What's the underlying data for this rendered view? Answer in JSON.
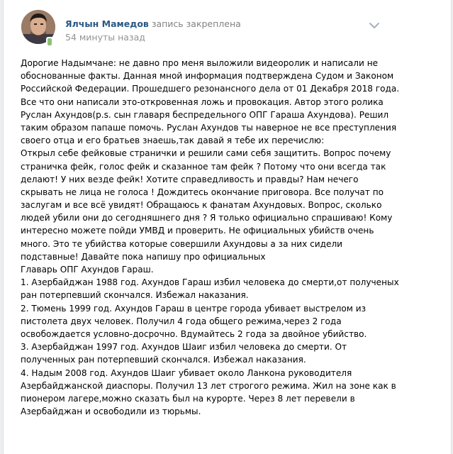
{
  "post": {
    "author_name": "Ялчын Мамедов",
    "action_text": "запись закреплена",
    "time": "54 минуты назад",
    "lines": [
      "Дорогие Надымчане: не давно про меня выложили видеоролик и написали не",
      "обоснованные факты. Данная мной информация подтверждена Судом и Законом",
      "Российской Федерации. Прошедшего резонансного дела от 01 Декабря 2018 года.",
      "Все что они написали это-откровенная ложь и провокация. Автор этого ролика",
      "Руслан Ахундов(p.s. сын главаря беспредельного ОПГ Гараша Ахундова). Решил",
      "таким образом папаше помочь. Руслан Ахундов ты наверное не все преступления",
      "своего отца и его братьев знаешь,так давай я тебе их перечислю:",
      "Открыл себе фейковые странички и решили сами себя защитить. Вопрос почему",
      "страничка фейк, голос фейк и сказанное там фейк ? Потому что они всегда так",
      "делают! У них везде фейк! Хотите справедливость и правды? Нам нечего",
      "скрывать не лица не голоса ! Дождитесь окончание приговора. Все получат по",
      "заслугам и все всё увидят! Обращаюсь к фанатам Ахундовых. Вопрос, сколько",
      "людей убили они до сегодняшнего дня ? Я только официально спрашиваю! Кому",
      "интересно можете пойди УМВД и проверить. Не официальных убийств очень",
      "много. Это те убийства которые совершили Ахундовы а за них сидели",
      "подставные! Давайте пока напишу про официальных",
      "Главарь ОПГ Ахундов Гараш.",
      "1. Азербайджан 1988 год. Ахундов Гараш избил человека до смерти,от полученых",
      "ран потерпевший скончался. Избежал наказания.",
      "2. Тюмень 1999 год. Ахундов Гараш в центре города убивает выстрелом из",
      "пистолета двух человек. Получил 4 года общего режима,через 2 года",
      "освобождается условно-досрочно. Вдумайтесь 2 года за двойное убийство.",
      "3. Азербайджан 1997 год. Ахундов Шаиг избил человека до смерти. От",
      "полученных ран потерпевший скончался. Избежал наказания.",
      "4. Надым 2008 год. Ахундов Шаиг убивает около Ланкона руководителя",
      "Азербайджанской диаспоры. Получил 13 лет строгого режима. Жил на зоне как в",
      "пионером лагере,можно сказать был на курорте. Через 8 лет перевели в",
      "Азербайджан и освободили из тюрьмы."
    ]
  }
}
